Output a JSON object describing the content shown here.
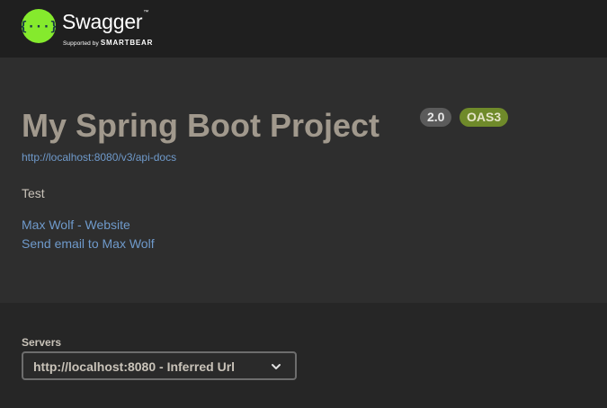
{
  "header": {
    "logo_title": "Swagger",
    "logo_supported_by": "Supported by",
    "logo_brand": "SMARTBEAR",
    "logo_icon_text": "{···}"
  },
  "info": {
    "title": "My Spring Boot Project",
    "version_badge": "2.0",
    "oas_badge": "OAS3",
    "api_docs_url": "http://localhost:8080/v3/api-docs",
    "description": "Test",
    "contact_website": "Max Wolf - Website",
    "contact_email": "Send email to Max Wolf"
  },
  "servers": {
    "label": "Servers",
    "selected": "http://localhost:8080 - Inferred Url"
  },
  "colors": {
    "logo_green": "#85ea2d",
    "link_blue": "#6f9acb",
    "title_gray": "#a1998d",
    "oas_badge_green": "#6f8a2a"
  },
  "icons": {
    "logo": "swagger-logo-icon",
    "dropdown": "chevron-down-icon"
  }
}
